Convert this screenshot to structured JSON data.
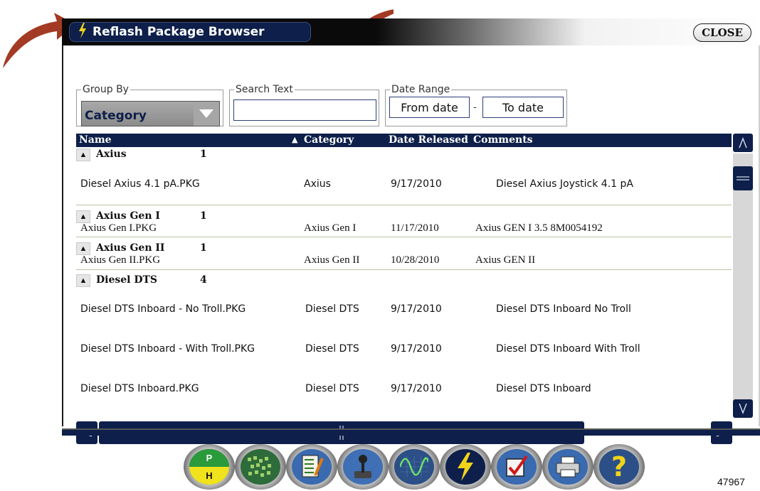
{
  "window": {
    "title": "Reflash Package Browser",
    "close_label": "CLOSE"
  },
  "filters": {
    "group_by": {
      "label": "Group By",
      "value": "Category"
    },
    "search": {
      "label": "Search Text",
      "value": ""
    },
    "date_range": {
      "label": "Date Range",
      "from": "From date",
      "separator": "-",
      "to": "To date"
    }
  },
  "grid": {
    "columns": [
      "Name",
      "Category",
      "Date Released",
      "Comments"
    ],
    "groups": [
      {
        "name": "Axius",
        "count": "1",
        "rows": [
          {
            "name": "Diesel Axius 4.1 pA.PKG",
            "category": "Axius",
            "date": "9/17/2010",
            "comments": "Diesel Axius Joystick 4.1 pA"
          }
        ]
      },
      {
        "name": "Axius Gen I",
        "count": "1",
        "rows": [
          {
            "name": "Axius Gen I.PKG",
            "category": "Axius Gen I",
            "date": "11/17/2010",
            "comments": "Axius GEN I 3.5 8M0054192"
          }
        ]
      },
      {
        "name": "Axius Gen II",
        "count": "1",
        "rows": [
          {
            "name": "Axius Gen II.PKG",
            "category": "Axius Gen II",
            "date": "10/28/2010",
            "comments": "Axius GEN II"
          }
        ]
      },
      {
        "name": "Diesel DTS",
        "count": "4",
        "rows": [
          {
            "name": "Diesel DTS Inboard - No Troll.PKG",
            "category": "Diesel DTS",
            "date": "9/17/2010",
            "comments": "Diesel DTS Inboard No Troll"
          },
          {
            "name": "Diesel DTS Inboard - With Troll.PKG",
            "category": "Diesel DTS",
            "date": "9/17/2010",
            "comments": "Diesel DTS Inboard With Troll"
          },
          {
            "name": "Diesel DTS Inboard.PKG",
            "category": "Diesel DTS",
            "date": "9/17/2010",
            "comments": "Diesel DTS Inboard"
          }
        ]
      }
    ]
  },
  "toolbar": {
    "icons": [
      "ph-mode-icon",
      "sensor-grid-icon",
      "checklist-icon",
      "joystick-icon",
      "waveform-icon",
      "reflash-bolt-icon",
      "checkbox-icon",
      "printer-icon",
      "help-icon"
    ],
    "ph_top": "P",
    "ph_bottom": "H",
    "help_glyph": "?"
  },
  "figure_id": "47967",
  "colors": {
    "navy": "#0d1f4a",
    "arrow_red": "#a33a24",
    "bolt_yellow": "#f2d21b"
  }
}
